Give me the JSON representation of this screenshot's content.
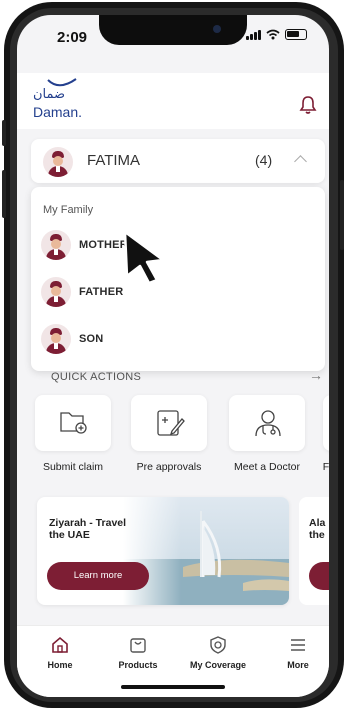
{
  "status_bar": {
    "time": "2:09"
  },
  "header": {
    "logo_arabic": "ضمان",
    "logo_text": "Daman."
  },
  "member_selector": {
    "name": "FATIMA",
    "count": "(4)"
  },
  "family_dropdown": {
    "title": "My Family",
    "members": [
      {
        "label": "MOTHER"
      },
      {
        "label": "FATHER"
      },
      {
        "label": "SON"
      }
    ]
  },
  "quick_actions": {
    "title": "QUICK ACTIONS",
    "items": [
      {
        "label": "Submit claim",
        "icon": "folder-plus-icon"
      },
      {
        "label": "Pre approvals",
        "icon": "document-edit-icon"
      },
      {
        "label": "Meet a Doctor",
        "icon": "doctor-icon"
      },
      {
        "label": "F"
      }
    ]
  },
  "promos": [
    {
      "title": "Ziyarah - Travel the UAE",
      "button": "Learn more"
    },
    {
      "title": "Ala the"
    }
  ],
  "tabbar": {
    "items": [
      {
        "label": "Home",
        "icon": "home-icon"
      },
      {
        "label": "Products",
        "icon": "bag-icon"
      },
      {
        "label": "My Coverage",
        "icon": "shield-icon"
      },
      {
        "label": "More",
        "icon": "menu-icon"
      }
    ]
  },
  "colors": {
    "brand": "#7d1e34",
    "logo_blue": "#24408e",
    "background": "#f4f4f6"
  }
}
